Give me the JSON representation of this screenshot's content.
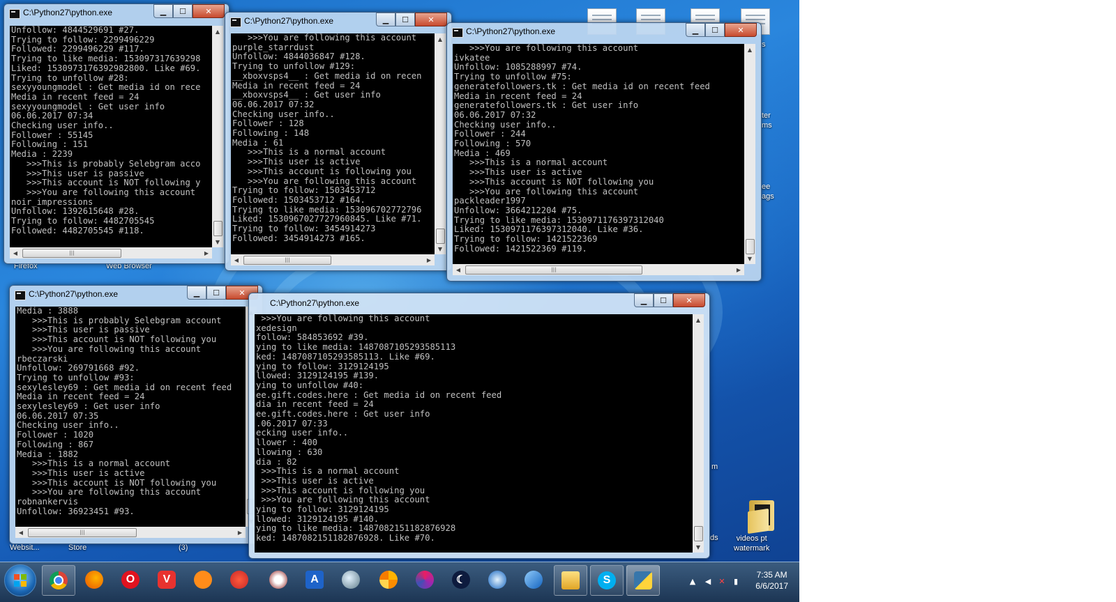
{
  "desktop": {
    "icon_labels": {
      "firefox": "Firefox",
      "web_browser": "Web Browser",
      "website": "Websit...",
      "store": "Store",
      "num3": "(3)",
      "ter": "ter",
      "ms": "ms",
      "s": "s",
      "ee": "ee",
      "ags": "ags",
      "m": "m",
      "ds": "ds",
      "folder_videos": "videos pt\nwatermark"
    }
  },
  "windows": [
    {
      "title": "C:\\Python27\\python.exe",
      "lines": [
        "Unfollow: 4844529691 #27.",
        "Trying to follow: 2299496229",
        "Followed: 2299496229 #117.",
        "Trying to like media: 153097317639298",
        "Liked: 1530973176392982800. Like #69.",
        "Trying to unfollow #28:",
        "sexyyoungmodel : Get media id on rece",
        "Media in recent feed = 24",
        "sexyyoungmodel : Get user info",
        "06.06.2017 07:34",
        "Checking user info..",
        "Follower : 55145",
        "Following : 151",
        "Media : 2239",
        "   >>>This is probably Selebgram acco",
        "   >>>This user is passive",
        "   >>>This account is NOT following y",
        "   >>>You are following this account",
        "noir_impressions",
        "Unfollow: 1392615648 #28.",
        "Trying to follow: 4482705545",
        "Followed: 4482705545 #118."
      ]
    },
    {
      "title": "C:\\Python27\\python.exe",
      "lines": [
        "   >>>You are following this account",
        "purple_starrdust",
        "Unfollow: 4844036847 #128.",
        "Trying to unfollow #129:",
        "__xboxvsps4__ : Get media id on recen",
        "Media in recent feed = 24",
        "__xboxvsps4__ : Get user info",
        "06.06.2017 07:32",
        "Checking user info..",
        "Follower : 128",
        "Following : 148",
        "Media : 61",
        "   >>>This is a normal account",
        "   >>>This user is active",
        "   >>>This account is following you",
        "   >>>You are following this account",
        "Trying to follow: 1503453712",
        "Followed: 1503453712 #164.",
        "Trying to like media: 153096702772796",
        "Liked: 1530967027727960845. Like #71.",
        "Trying to follow: 3454914273",
        "Followed: 3454914273 #165."
      ]
    },
    {
      "title": "C:\\Python27\\python.exe",
      "lines": [
        "   >>>You are following this account",
        "ivkatee",
        "Unfollow: 1085288997 #74.",
        "Trying to unfollow #75:",
        "generatefollowers.tk : Get media id on recent feed",
        "Media in recent feed = 24",
        "generatefollowers.tk : Get user info",
        "06.06.2017 07:32",
        "Checking user info..",
        "Follower : 244",
        "Following : 570",
        "Media : 469",
        "   >>>This is a normal account",
        "   >>>This user is active",
        "   >>>This account is NOT following you",
        "   >>>You are following this account",
        "packleader1997",
        "Unfollow: 3664212204 #75.",
        "Trying to like media: 1530971176397312040",
        "Liked: 1530971176397312040. Like #36.",
        "Trying to follow: 1421522369",
        "Followed: 1421522369 #119."
      ]
    },
    {
      "title": "C:\\Python27\\python.exe",
      "lines": [
        "Media : 3888",
        "   >>>This is probably Selebgram account",
        "   >>>This user is passive",
        "   >>>This account is NOT following you",
        "   >>>You are following this account",
        "rbeczarski",
        "Unfollow: 269791668 #92.",
        "Trying to unfollow #93:",
        "sexylesley69 : Get media id on recent feed",
        "Media in recent feed = 24",
        "sexylesley69 : Get user info",
        "06.06.2017 07:35",
        "Checking user info..",
        "Follower : 1020",
        "Following : 867",
        "Media : 1882",
        "   >>>This is a normal account",
        "   >>>This user is active",
        "   >>>This account is NOT following you",
        "   >>>You are following this account",
        "robnankervis",
        "Unfollow: 36923451 #93."
      ]
    },
    {
      "title": "C:\\Python27\\python.exe",
      "lines": [
        " >>>You are following this account",
        "xedesign",
        "follow: 584853692 #39.",
        "ying to like media: 1487087105293585113",
        "ked: 1487087105293585113. Like #69.",
        "ying to follow: 3129124195",
        "llowed: 3129124195 #139.",
        "ying to unfollow #40:",
        "ee.gift.codes.here : Get media id on recent feed",
        "dia in recent feed = 24",
        "ee.gift.codes.here : Get user info",
        ".06.2017 07:33",
        "ecking user info..",
        "llower : 400",
        "llowing : 630",
        "dia : 82",
        " >>>This is a normal account",
        " >>>This user is active",
        " >>>This account is following you",
        " >>>You are following this account",
        "ying to follow: 3129124195",
        "llowed: 3129124195 #140.",
        "ying to like media: 1487082151182876928",
        "ked: 1487082151182876928. Like #70."
      ]
    }
  ],
  "window_controls": {
    "minimize": "▁",
    "maximize": "☐",
    "close": "✕"
  },
  "taskbar": {
    "apps": [
      "start-button",
      "chrome-icon",
      "firefox-icon",
      "opera-icon",
      "vivaldi-icon",
      "uc-browser-icon",
      "browser-icon",
      "eagle-icon",
      "arrow-app-icon",
      "globe-icon",
      "pinwheel-icon",
      "orb-icon",
      "moon-icon",
      "compass-icon",
      "bird-icon",
      "file-explorer-icon",
      "skype-icon",
      "python-icon"
    ],
    "skype_letter": "S",
    "vivaldi_letter": "V",
    "opera_letter": "O",
    "arrow_letter": "A",
    "time": "7:35 AM",
    "date": "6/6/2017"
  }
}
